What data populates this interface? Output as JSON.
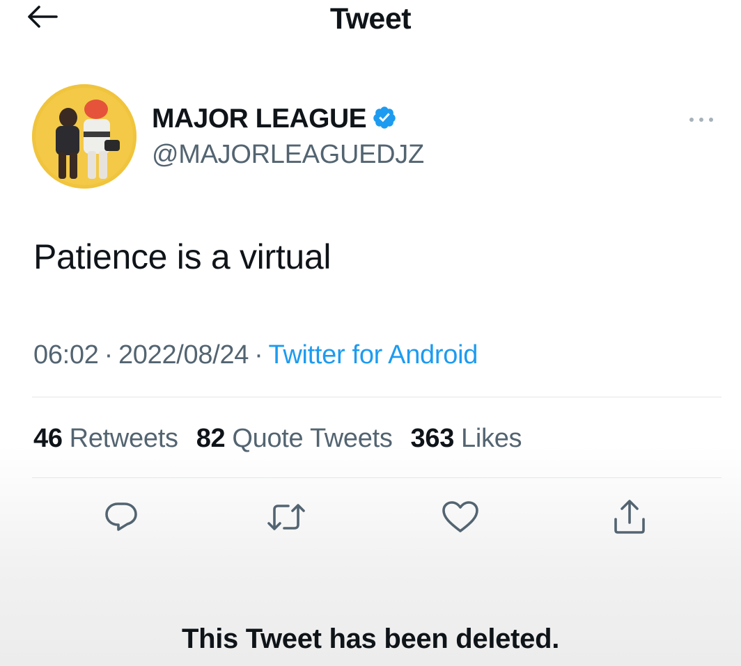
{
  "header": {
    "title": "Tweet",
    "back_icon": "arrow-left-icon"
  },
  "author": {
    "display_name": "MAJOR LEAGUE",
    "handle": "@MAJORLEAGUEDJZ",
    "verified": true,
    "verified_color": "#1d9bf0",
    "avatar_background": "#f0c43c"
  },
  "tweet": {
    "text": "Patience is a virtual",
    "time": "06:02",
    "date": "2022/08/24",
    "separator": "·",
    "source": "Twitter for Android"
  },
  "stats": {
    "retweets_count": "46",
    "retweets_label": "Retweets",
    "quotes_count": "82",
    "quotes_label": "Quote Tweets",
    "likes_count": "363",
    "likes_label": "Likes"
  },
  "actions": [
    "reply-icon",
    "retweet-icon",
    "like-icon",
    "share-icon"
  ],
  "notice": {
    "deleted_text": "This Tweet has been deleted."
  },
  "colors": {
    "text_primary": "#0f1419",
    "text_secondary": "#536471",
    "link": "#1d9bf0"
  }
}
